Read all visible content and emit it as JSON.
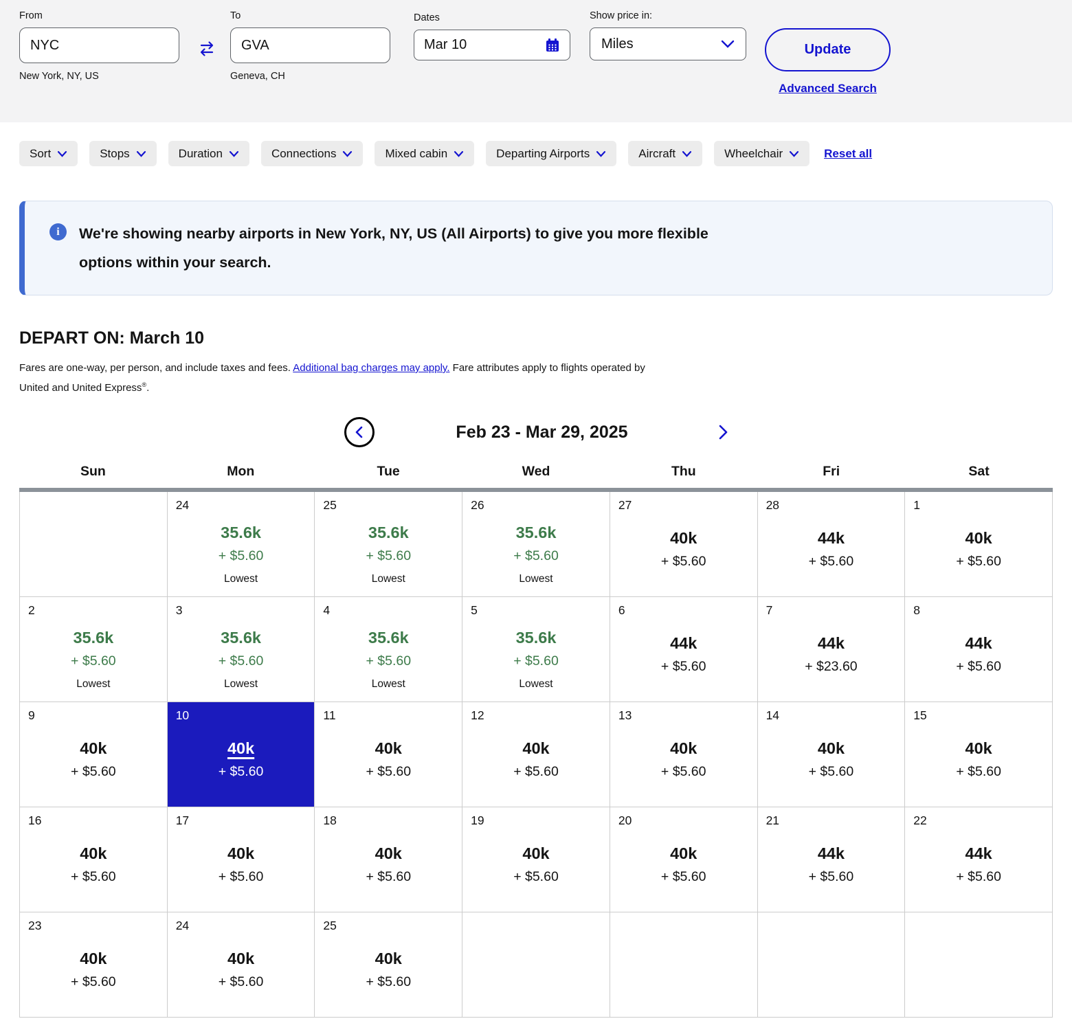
{
  "colors": {
    "accent": "#1414d0",
    "lowest_green": "#3d7b4a",
    "selected_blue": "#1b1bbd",
    "info_blue": "#3f6ad0"
  },
  "search": {
    "from": {
      "label": "From",
      "value": "NYC",
      "sublabel": "New York, NY, US"
    },
    "to": {
      "label": "To",
      "value": "GVA",
      "sublabel": "Geneva, CH"
    },
    "dates": {
      "label": "Dates",
      "value": "Mar 10"
    },
    "price_in": {
      "label": "Show price in:",
      "value": "Miles"
    },
    "update_label": "Update",
    "advanced_search_label": "Advanced Search"
  },
  "filters": {
    "items": [
      "Sort",
      "Stops",
      "Duration",
      "Connections",
      "Mixed cabin",
      "Departing Airports",
      "Aircraft",
      "Wheelchair"
    ],
    "reset_label": "Reset all"
  },
  "banner": {
    "text": "We're showing nearby airports in New York, NY, US (All Airports) to give you more flexible options within your search."
  },
  "depart": {
    "heading": "DEPART ON: March 10",
    "disclaimer_part1": "Fares are one-way, per person, and include taxes and fees. ",
    "disclaimer_link": "Additional bag charges may apply.",
    "disclaimer_part2": " Fare attributes apply to flights operated by United and United Express",
    "disclaimer_sup": "®",
    "disclaimer_part3": "."
  },
  "calendar": {
    "nav_title": "Feb 23 - Mar 29, 2025",
    "day_headers": [
      "Sun",
      "Mon",
      "Tue",
      "Wed",
      "Thu",
      "Fri",
      "Sat"
    ],
    "weeks": [
      [
        null,
        {
          "day": "24",
          "miles": "35.6k",
          "fee": "+ $5.60",
          "badge": "Lowest",
          "style": "lowest"
        },
        {
          "day": "25",
          "miles": "35.6k",
          "fee": "+ $5.60",
          "badge": "Lowest",
          "style": "lowest"
        },
        {
          "day": "26",
          "miles": "35.6k",
          "fee": "+ $5.60",
          "badge": "Lowest",
          "style": "lowest"
        },
        {
          "day": "27",
          "miles": "40k",
          "fee": "+ $5.60",
          "style": "standard"
        },
        {
          "day": "28",
          "miles": "44k",
          "fee": "+ $5.60",
          "style": "standard"
        },
        {
          "day": "1",
          "miles": "40k",
          "fee": "+ $5.60",
          "style": "standard"
        }
      ],
      [
        {
          "day": "2",
          "miles": "35.6k",
          "fee": "+ $5.60",
          "badge": "Lowest",
          "style": "lowest"
        },
        {
          "day": "3",
          "miles": "35.6k",
          "fee": "+ $5.60",
          "badge": "Lowest",
          "style": "lowest"
        },
        {
          "day": "4",
          "miles": "35.6k",
          "fee": "+ $5.60",
          "badge": "Lowest",
          "style": "lowest"
        },
        {
          "day": "5",
          "miles": "35.6k",
          "fee": "+ $5.60",
          "badge": "Lowest",
          "style": "lowest"
        },
        {
          "day": "6",
          "miles": "44k",
          "fee": "+ $5.60",
          "style": "standard"
        },
        {
          "day": "7",
          "miles": "44k",
          "fee": "+ $23.60",
          "style": "standard"
        },
        {
          "day": "8",
          "miles": "44k",
          "fee": "+ $5.60",
          "style": "standard"
        }
      ],
      [
        {
          "day": "9",
          "miles": "40k",
          "fee": "+ $5.60",
          "style": "standard"
        },
        {
          "day": "10",
          "miles": "40k",
          "fee": "+ $5.60",
          "style": "selected"
        },
        {
          "day": "11",
          "miles": "40k",
          "fee": "+ $5.60",
          "style": "standard"
        },
        {
          "day": "12",
          "miles": "40k",
          "fee": "+ $5.60",
          "style": "standard"
        },
        {
          "day": "13",
          "miles": "40k",
          "fee": "+ $5.60",
          "style": "standard"
        },
        {
          "day": "14",
          "miles": "40k",
          "fee": "+ $5.60",
          "style": "standard"
        },
        {
          "day": "15",
          "miles": "40k",
          "fee": "+ $5.60",
          "style": "standard"
        }
      ],
      [
        {
          "day": "16",
          "miles": "40k",
          "fee": "+ $5.60",
          "style": "standard"
        },
        {
          "day": "17",
          "miles": "40k",
          "fee": "+ $5.60",
          "style": "standard"
        },
        {
          "day": "18",
          "miles": "40k",
          "fee": "+ $5.60",
          "style": "standard"
        },
        {
          "day": "19",
          "miles": "40k",
          "fee": "+ $5.60",
          "style": "standard"
        },
        {
          "day": "20",
          "miles": "40k",
          "fee": "+ $5.60",
          "style": "standard"
        },
        {
          "day": "21",
          "miles": "44k",
          "fee": "+ $5.60",
          "style": "standard"
        },
        {
          "day": "22",
          "miles": "44k",
          "fee": "+ $5.60",
          "style": "standard"
        }
      ],
      [
        {
          "day": "23",
          "miles": "40k",
          "fee": "+ $5.60",
          "style": "standard"
        },
        {
          "day": "24",
          "miles": "40k",
          "fee": "+ $5.60",
          "style": "standard"
        },
        {
          "day": "25",
          "miles": "40k",
          "fee": "+ $5.60",
          "style": "standard"
        },
        null,
        null,
        null,
        null
      ]
    ]
  }
}
